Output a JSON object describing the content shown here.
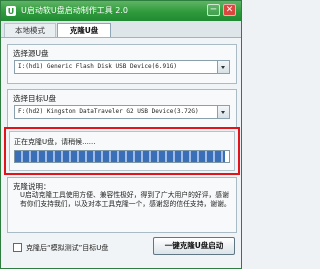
{
  "window": {
    "title": "U启动软U盘启动制作工具 2.0"
  },
  "titlebar": {
    "minimize": "─",
    "close": "✕"
  },
  "tabs": [
    {
      "label": "本地模式"
    },
    {
      "label": "克隆U盘"
    }
  ],
  "source": {
    "label": "选择源U盘",
    "value": "I:(hd1) Generic Flash Disk USB Device(6.91G)"
  },
  "target": {
    "label": "选择目标U盘",
    "value": "F:(hd2) Kingston DataTraveler G2 USB Device(3.72G)"
  },
  "progress": {
    "status_text": "正在克隆U盘，请稍候......",
    "fraction": 0.98
  },
  "description": {
    "label": "克隆说明：",
    "text": "U启动克隆工具使用方便、兼容性极好，得到了广大用户的好评，感谢有你们支持我们，以及对本工具克隆一个，感谢您的信任支持，谢谢。"
  },
  "options": {
    "simulate_test_label": "克隆后“模拟测试”目标U盘"
  },
  "actions": {
    "make_label": "一键克隆U盘启动"
  },
  "colors": {
    "title_bar": "#2f9a3c",
    "highlight_border": "#e0141a",
    "progress": "#3a6fb8"
  }
}
